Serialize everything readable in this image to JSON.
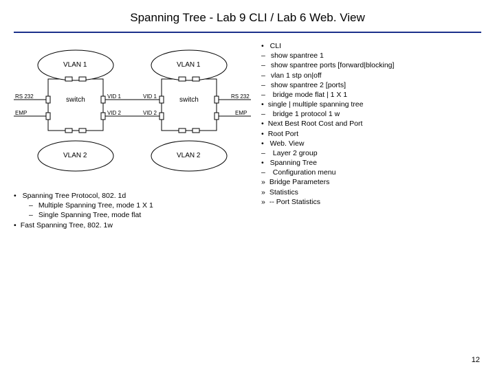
{
  "title": "Spanning Tree - Lab 9 CLI / Lab 6 Web. View",
  "diagram": {
    "vlan1_left": "VLAN 1",
    "vlan1_right": "VLAN 1",
    "vlan2_left": "VLAN 2",
    "vlan2_right": "VLAN 2",
    "switch_left": "switch",
    "switch_right": "switch",
    "rs232_left": "RS 232",
    "rs232_right": "RS 232",
    "emp_left": "EMP",
    "emp_right": "EMP",
    "vid1_a": "VID 1",
    "vid1_b": "VID 1",
    "vid2_a": "VID 2",
    "vid2_b": "VID 2"
  },
  "leftNotes": {
    "l1": "Spanning Tree Protocol, 802. 1d",
    "l1a": "Multiple Spanning Tree, mode 1 X 1",
    "l1b": "Single Spanning Tree, mode flat",
    "l2": "Fast Spanning Tree, 802. 1w"
  },
  "right": {
    "cli": "CLI",
    "c1": "show spantree 1",
    "c2": "show spantree ports [forward|blocking]",
    "c3": "vlan 1 stp on|off",
    "c4": "show spantree 2 [ports]",
    "c5": "bridge mode flat | 1 X 1",
    "c5a": "single | multiple spanning tree",
    "c6": "bridge 1 protocol 1 w",
    "c6a": "Next Best Root Cost and Port",
    "c6b": "Root Port",
    "web": "Web. View",
    "w1": "Layer 2 group",
    "w1a": "Spanning Tree",
    "w1a1": "Configuration menu",
    "w1a1a": "Bridge Parameters",
    "w1a1b": "Statistics",
    "w1a1c": "-- Port Statistics"
  },
  "pagenum": "12"
}
